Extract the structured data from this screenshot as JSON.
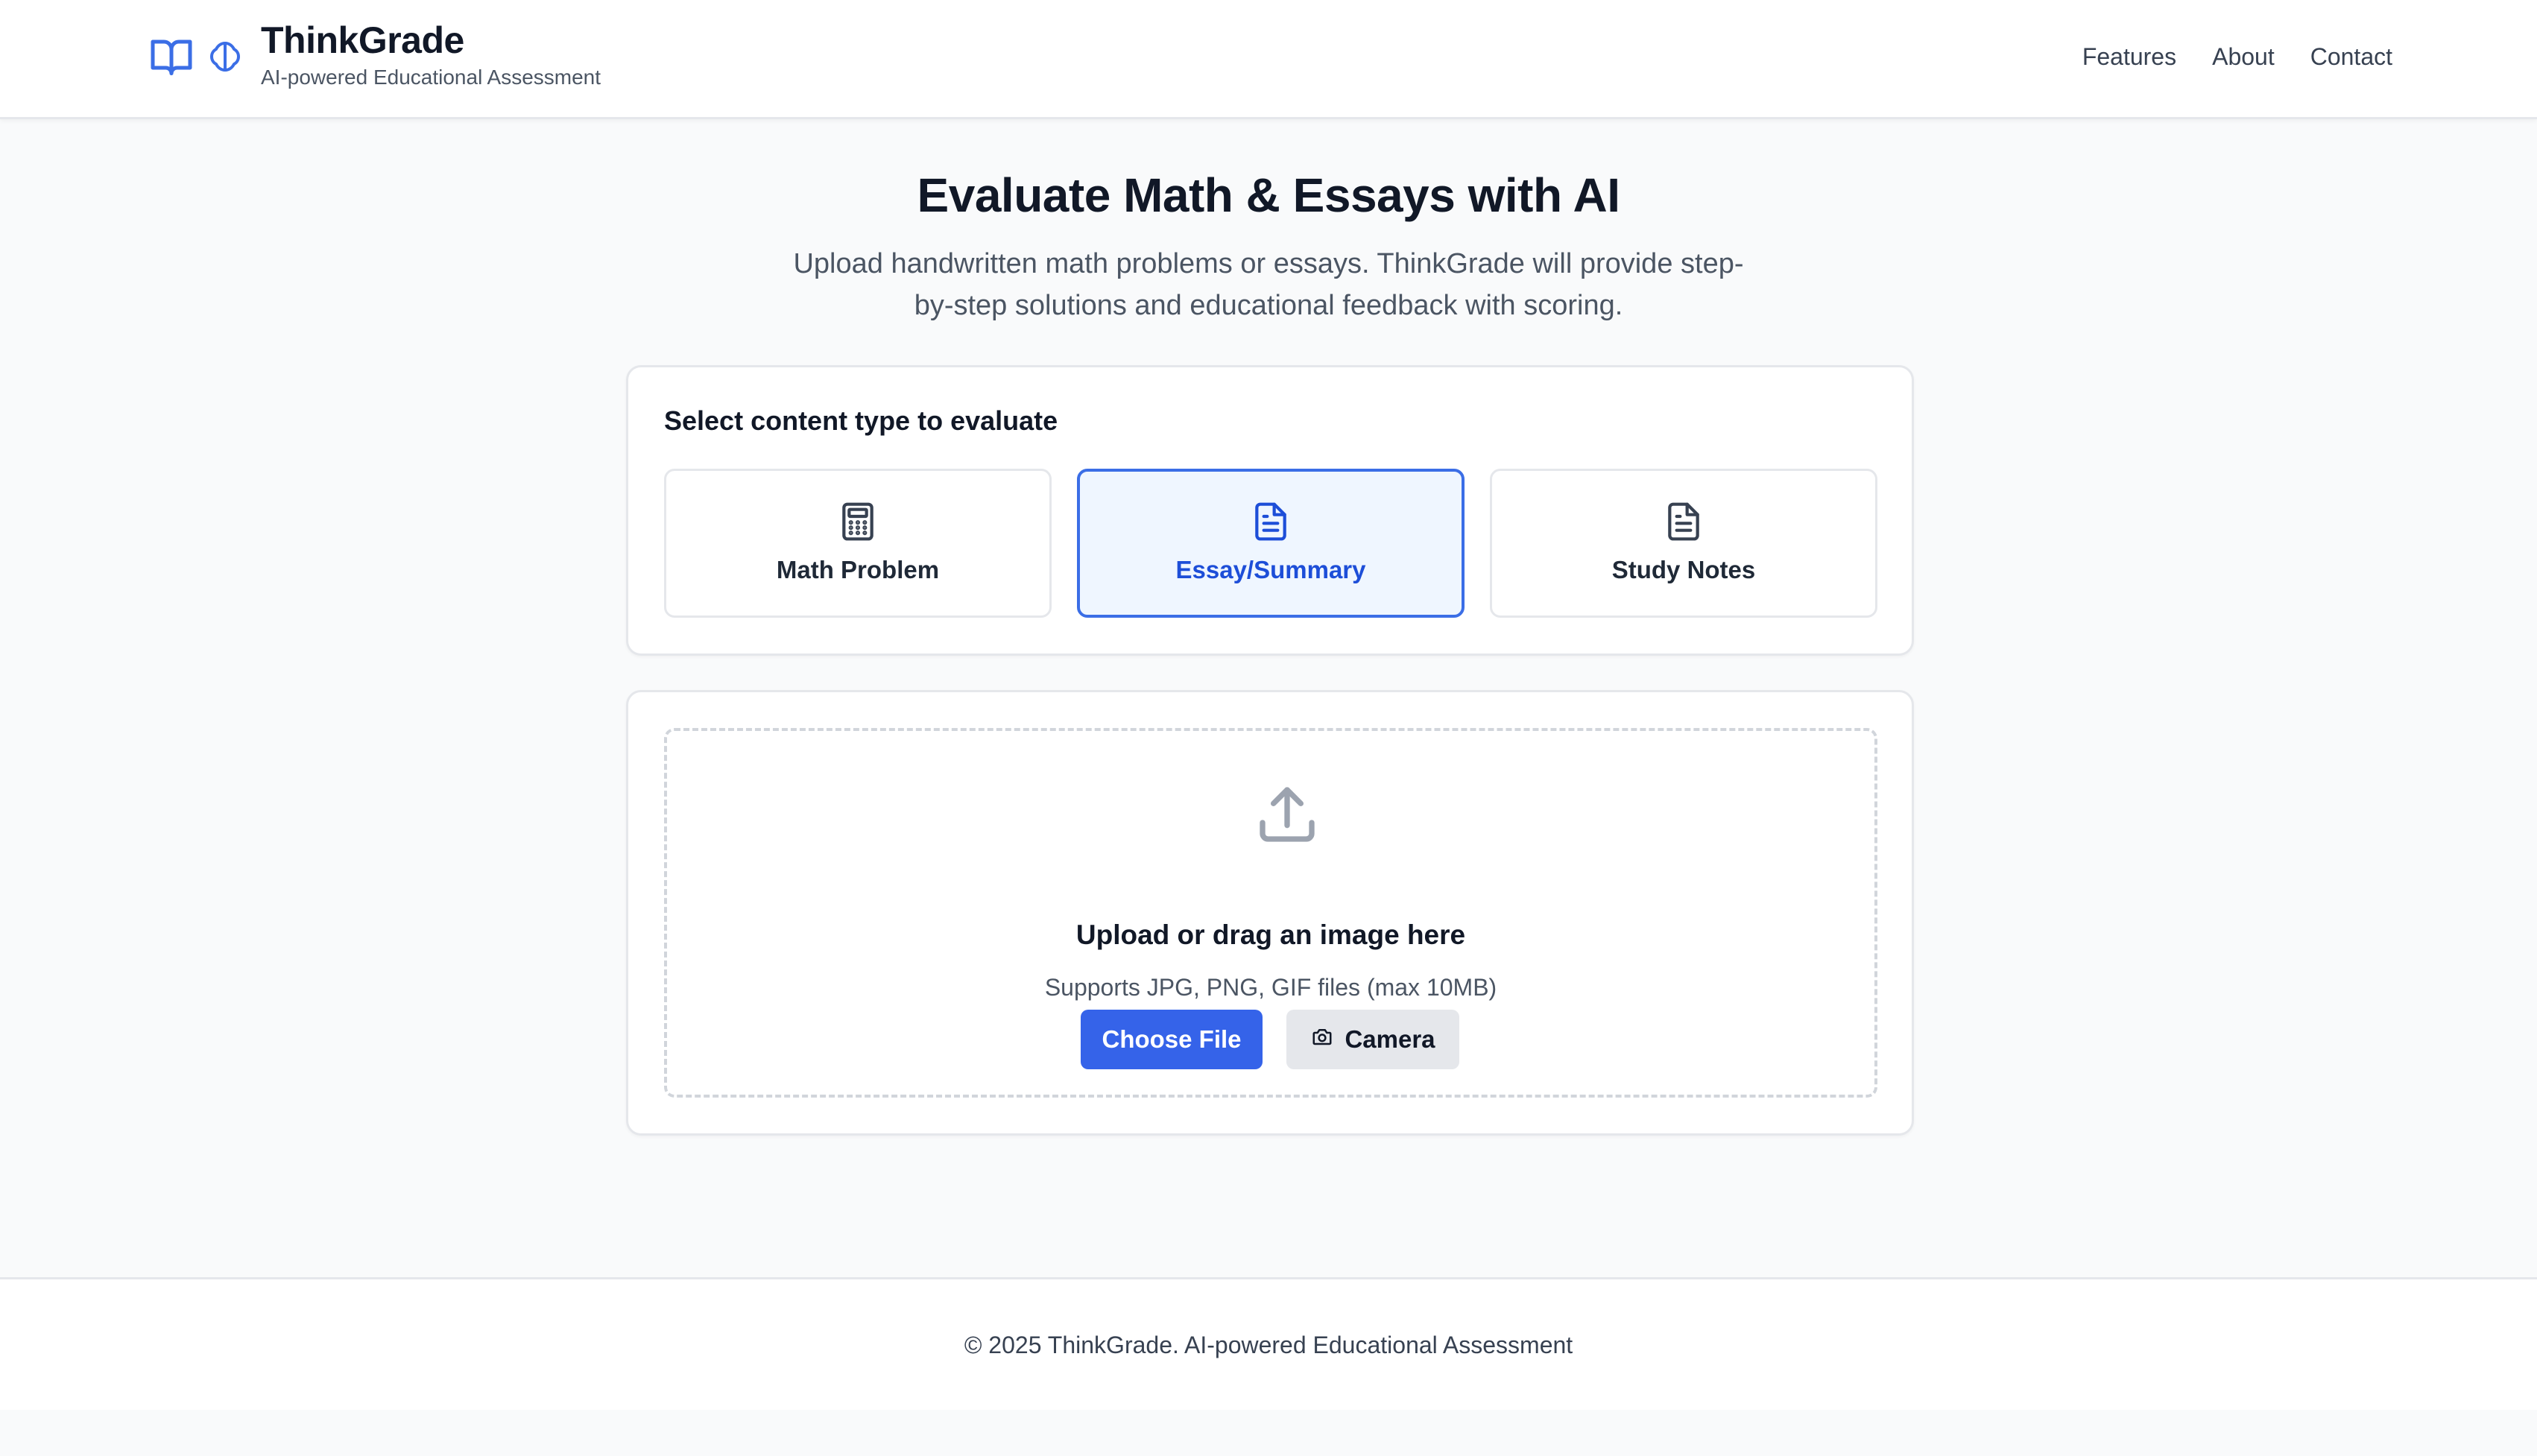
{
  "header": {
    "brand_title": "ThinkGrade",
    "brand_subtitle": "AI-powered Educational Assessment",
    "icons": [
      "book-open-icon",
      "brain-icon"
    ],
    "nav": [
      "Features",
      "About",
      "Contact"
    ]
  },
  "hero": {
    "title": "Evaluate Math & Essays with AI",
    "description": "Upload handwritten math problems or essays. ThinkGrade will provide step-by-step solutions and educational feedback with scoring."
  },
  "content_type": {
    "label": "Select content type to evaluate",
    "options": [
      {
        "label": "Math Problem",
        "icon": "calculator-icon",
        "selected": false
      },
      {
        "label": "Essay/Summary",
        "icon": "document-icon",
        "selected": true
      },
      {
        "label": "Study Notes",
        "icon": "document-icon",
        "selected": false
      }
    ]
  },
  "upload": {
    "icon": "upload-icon",
    "title": "Upload or drag an image here",
    "subtitle": "Supports JPG, PNG, GIF files (max 10MB)",
    "choose_file_label": "Choose File",
    "camera_label": "Camera"
  },
  "footer": {
    "text": "© 2025 ThinkGrade. AI-powered Educational Assessment"
  },
  "colors": {
    "accent": "#3563e9",
    "selected_bg": "#eff6ff",
    "page_bg": "#f9fafb"
  }
}
